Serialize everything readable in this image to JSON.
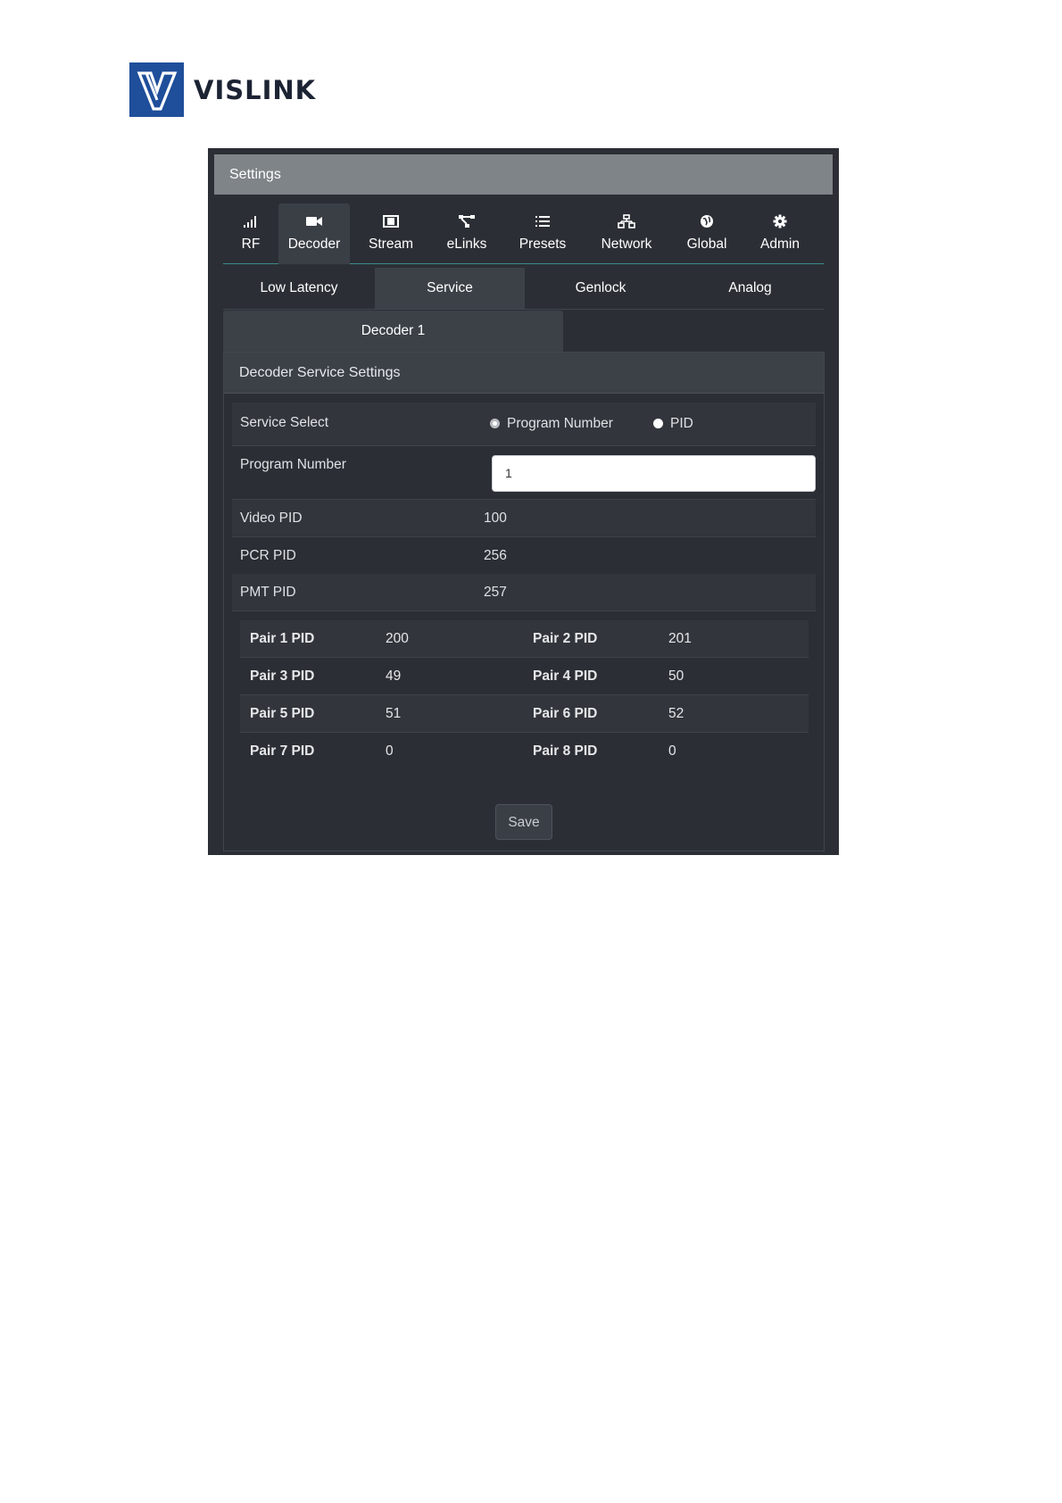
{
  "brand": {
    "name": "VISLINK"
  },
  "window": {
    "title": "Settings"
  },
  "main_tabs": [
    {
      "label": "RF",
      "icon": "signal-icon"
    },
    {
      "label": "Decoder",
      "icon": "video-camera-icon"
    },
    {
      "label": "Stream",
      "icon": "film-icon"
    },
    {
      "label": "eLinks",
      "icon": "sitemap-icon"
    },
    {
      "label": "Presets",
      "icon": "list-icon"
    },
    {
      "label": "Network",
      "icon": "network-icon"
    },
    {
      "label": "Global",
      "icon": "globe-icon"
    },
    {
      "label": "Admin",
      "icon": "gear-icon"
    }
  ],
  "active_main_tab": "Decoder",
  "sub_tabs": [
    {
      "label": "Low Latency"
    },
    {
      "label": "Service"
    },
    {
      "label": "Genlock"
    },
    {
      "label": "Analog"
    }
  ],
  "active_sub_tab": "Service",
  "decoder_tab": {
    "label": "Decoder 1"
  },
  "panel": {
    "title": "Decoder Service Settings",
    "service_select": {
      "label": "Service Select",
      "options": [
        {
          "label": "Program Number",
          "selected": true
        },
        {
          "label": "PID",
          "selected": false
        }
      ]
    },
    "program_number": {
      "label": "Program Number",
      "value": "1"
    },
    "video_pid": {
      "label": "Video PID",
      "value": "100"
    },
    "pcr_pid": {
      "label": "PCR PID",
      "value": "256"
    },
    "pmt_pid": {
      "label": "PMT PID",
      "value": "257"
    },
    "pairs": [
      {
        "label": "Pair 1 PID",
        "value": "200"
      },
      {
        "label": "Pair 2 PID",
        "value": "201"
      },
      {
        "label": "Pair 3 PID",
        "value": "49"
      },
      {
        "label": "Pair 4 PID",
        "value": "50"
      },
      {
        "label": "Pair 5 PID",
        "value": "51"
      },
      {
        "label": "Pair 6 PID",
        "value": "52"
      },
      {
        "label": "Pair 7 PID",
        "value": "0"
      },
      {
        "label": "Pair 8 PID",
        "value": "0"
      }
    ],
    "save_label": "Save"
  },
  "colors": {
    "brand_blue": "#1f4e9a",
    "panel_bg": "#2b2f35",
    "header_bg": "#7f8489",
    "tab_underline": "#3d8b8d"
  }
}
